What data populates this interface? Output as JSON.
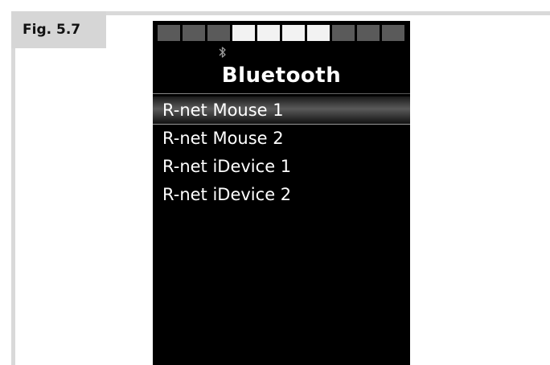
{
  "figure": {
    "label": "Fig. 5.7"
  },
  "screen": {
    "segments": [
      {
        "state": "off"
      },
      {
        "state": "off"
      },
      {
        "state": "off"
      },
      {
        "state": "on"
      },
      {
        "state": "on"
      },
      {
        "state": "on"
      },
      {
        "state": "on"
      },
      {
        "state": "off"
      },
      {
        "state": "off"
      },
      {
        "state": "off"
      }
    ],
    "status_icon": "bluetooth-icon",
    "title": "Bluetooth",
    "menu": [
      {
        "label": "R-net Mouse 1",
        "selected": true
      },
      {
        "label": "R-net Mouse 2",
        "selected": false
      },
      {
        "label": "R-net iDevice 1",
        "selected": false
      },
      {
        "label": "R-net iDevice 2",
        "selected": false
      }
    ]
  },
  "colors": {
    "screen_background": "#000000",
    "segment_on": "#f2f2f2",
    "segment_off": "#5a5a5a",
    "text": "#ffffff",
    "label_background": "#d6d6d6"
  }
}
